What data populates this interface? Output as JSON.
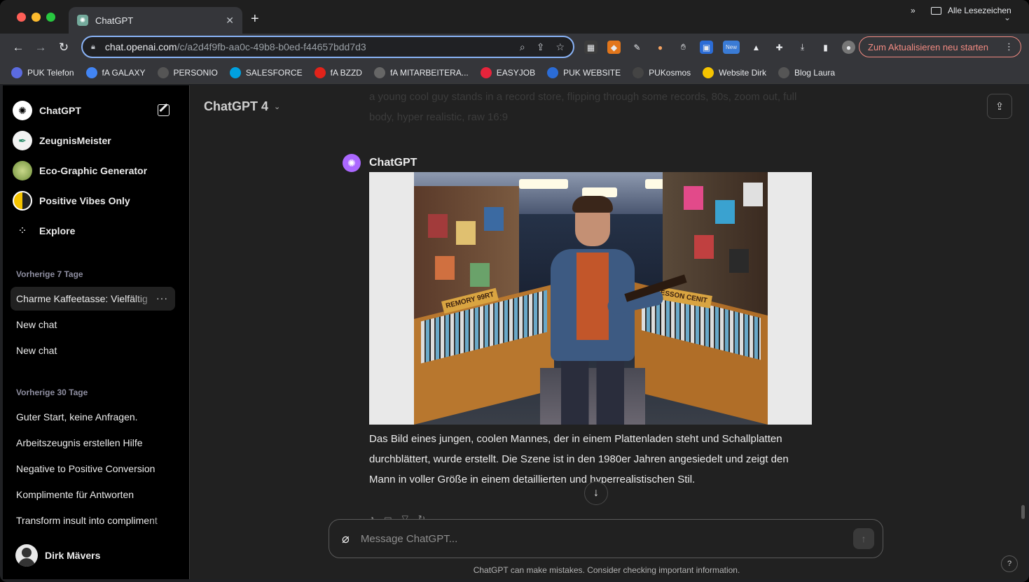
{
  "browser": {
    "tab_title": "ChatGPT",
    "url_host": "chat.openai.com",
    "url_path": "/c/a2d4f9fb-aa0c-49b8-b0ed-f44657bdd7d3",
    "update_label": "Zum Aktualisieren neu starten",
    "ext_new_badge": "New",
    "bookmarks": [
      {
        "label": "PUK Telefon",
        "color": "#5b6be0"
      },
      {
        "label": "fA GALAXY",
        "color": "#4285f4"
      },
      {
        "label": "PERSONIO",
        "color": "#555555"
      },
      {
        "label": "SALESFORCE",
        "color": "#00a1e0"
      },
      {
        "label": "fA BZZD",
        "color": "#e2231a"
      },
      {
        "label": "fA MITARBEITERA...",
        "color": "#666666"
      },
      {
        "label": "EASYJOB",
        "color": "#e5243b"
      },
      {
        "label": "PUK WEBSITE",
        "color": "#2b6cd6"
      },
      {
        "label": "PUKosmos",
        "color": "#444444"
      },
      {
        "label": "Website Dirk",
        "color": "#f5c400"
      },
      {
        "label": "Blog Laura",
        "color": "#555555"
      }
    ],
    "bookmarks_overflow": "»",
    "all_bookmarks": "Alle Lesezeichen"
  },
  "sidebar": {
    "top_items": [
      {
        "label": "ChatGPT"
      },
      {
        "label": "ZeugnisMeister"
      },
      {
        "label": "Eco-Graphic Generator"
      },
      {
        "label": "Positive Vibes Only"
      },
      {
        "label": "Explore"
      }
    ],
    "section_7": "Vorherige 7 Tage",
    "chats_7": [
      "Charme Kaffeetasse: Vielfältig",
      "New chat",
      "New chat"
    ],
    "section_30": "Vorherige 30 Tage",
    "chats_30": [
      "Guter Start, keine Anfragen.",
      "Arbeitszeugnis erstellen Hilfe",
      "Negative to Positive Conversion",
      "Komplimente für Antworten",
      "Transform insult into compliment"
    ],
    "user_name": "Dirk Mävers"
  },
  "main": {
    "model_title": "ChatGPT 4",
    "prev_prompt": "a young cool guy stands in a record store, flipping through some records, 80s, zoom out, full body, hyper realistic, raw 16:9",
    "assistant_name": "ChatGPT",
    "image_sign_left": "REMORY 99RT",
    "image_sign_right": "ESSON CENIT",
    "message": "Das Bild eines jungen, coolen Mannes, der in einem Plattenladen steht und Schallplatten durchblättert, wurde erstellt. Die Szene ist in den 1980er Jahren angesiedelt und zeigt den Mann in voller Größe in einem detaillierten und hyperrealistischen Stil.",
    "composer_placeholder": "Message ChatGPT...",
    "disclaimer": "ChatGPT can make mistakes. Consider checking important information.",
    "help_label": "?"
  }
}
